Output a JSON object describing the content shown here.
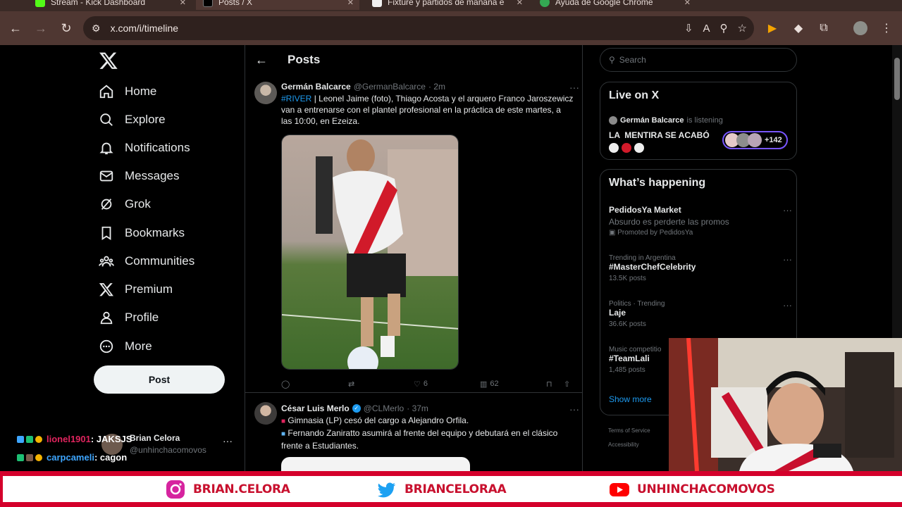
{
  "browser": {
    "tabs": [
      {
        "label": "Stream - Kick Dashboard",
        "fav": "#53fc18"
      },
      {
        "label": "Posts / X",
        "fav": "#000000"
      },
      {
        "label": "Fixture y partidos de mañana e",
        "fav": "#f0f0f0"
      },
      {
        "label": "Ayuda de Google Chrome",
        "fav": "#34a853"
      }
    ],
    "url": "x.com/i/timeline"
  },
  "nav": {
    "items": [
      "Home",
      "Explore",
      "Notifications",
      "Messages",
      "Grok",
      "Bookmarks",
      "Communities",
      "Premium",
      "Profile",
      "More"
    ],
    "post_label": "Post",
    "account_name": "Brian Celora",
    "account_handle": "@unhinchacomovos"
  },
  "main": {
    "title": "Posts",
    "tweets": [
      {
        "name": "Germán Balcarce",
        "handle": "@GermanBalcarce",
        "time": "· 2m",
        "hashtag": "#RIVER",
        "text": " | Leonel Jaime (foto), Thiago Acosta y el arquero Franco Jaroszewicz van a entrenarse con el plantel profesional en la práctica de este martes, a las 10:00, en Ezeiza.",
        "likes": "6",
        "views": "62"
      },
      {
        "name": "César Luis Merlo",
        "handle": "@CLMerlo",
        "time": "· 37m",
        "line1": "Gimnasia (LP) cesó del cargo a Alejandro Orfila.",
        "line2": "Fernando Zaniratto asumirá al frente del equipo y debutará en el clásico frente a Estudiantes."
      }
    ]
  },
  "sidebar": {
    "search_placeholder": "Search",
    "live": {
      "title": "Live on X",
      "host": "Germán Balcarce",
      "status": "is listening",
      "space_title": "LA  MENTIRA SE ACABÓ",
      "listeners": "+142"
    },
    "happening": {
      "title": "What’s happening",
      "trends": [
        {
          "meta": "",
          "name": "PedidosYa Market",
          "desc": "Absurdo es perderte las promos",
          "count": "Promoted by PedidosYa"
        },
        {
          "meta": "Trending in Argentina",
          "name": "#MasterChefCelebrity",
          "desc": "",
          "count": "13.5K posts"
        },
        {
          "meta": "Politics · Trending",
          "name": "Laje",
          "desc": "",
          "count": "36.6K posts"
        },
        {
          "meta": "Music competitio",
          "name": "#TeamLali",
          "desc": "",
          "count": "1,485 posts"
        }
      ],
      "show_more": "Show more"
    },
    "footer": [
      "Terms of Service",
      "Accessibility"
    ]
  },
  "stream": {
    "chat": [
      {
        "user": "lionel1901",
        "message": ": JAKSJS",
        "color": "#e0245e"
      },
      {
        "user": "carpcameli",
        "message": ": cagon",
        "color": "#3ea6ff"
      }
    ],
    "socials": [
      "BRIAN.CELORA",
      "BRIANCELORAA",
      "UNHINCHACOMOVOS"
    ]
  }
}
